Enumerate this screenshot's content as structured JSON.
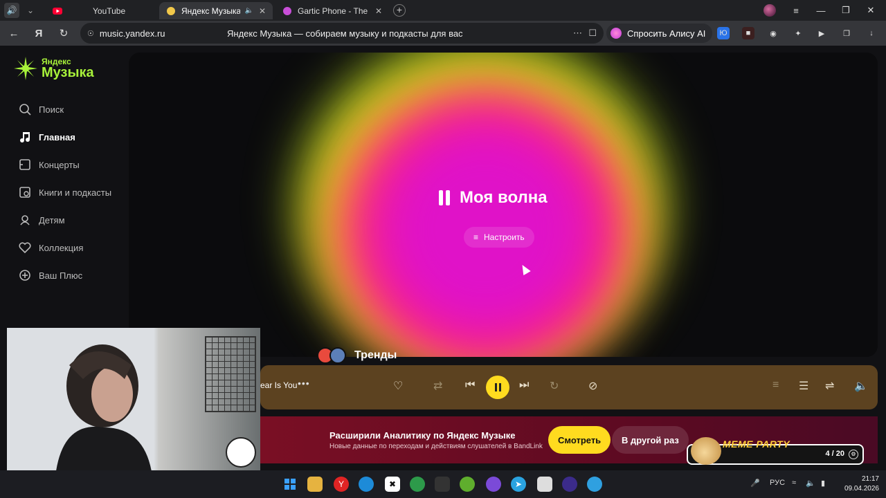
{
  "browser": {
    "tabs": [
      {
        "label": "YouTube",
        "active": false
      },
      {
        "label": "Яндекс Музыка — со",
        "active": true
      },
      {
        "label": "Gartic Phone - The Teleph",
        "active": false
      }
    ],
    "url_host": "music.yandex.ru",
    "page_title": "Яндекс Музыка — собираем музыку и подкасты для вас",
    "alice_label": "Спросить Алису AI"
  },
  "sidebar": {
    "logo_small": "Яндекс",
    "logo_big": "Музыка",
    "items": [
      {
        "label": "Поиск",
        "icon": "search-icon",
        "active": false
      },
      {
        "label": "Главная",
        "icon": "music-note-icon",
        "active": true
      },
      {
        "label": "Концерты",
        "icon": "ticket-icon",
        "active": false
      },
      {
        "label": "Книги и подкасты",
        "icon": "book-icon",
        "active": false
      },
      {
        "label": "Детям",
        "icon": "kids-icon",
        "active": false
      },
      {
        "label": "Коллекция",
        "icon": "heart-icon",
        "active": false
      },
      {
        "label": "Ваш Плюс",
        "icon": "plus-icon",
        "active": false
      }
    ]
  },
  "hero": {
    "title": "Моя волна",
    "tune_label": "Настроить"
  },
  "trends": {
    "title": "Тренды"
  },
  "player": {
    "track_title": "ear Is You",
    "accent": "#ffdb1f"
  },
  "banner": {
    "title": "Расширили Аналитику по Яндекс Музыке",
    "subtitle": "Новые данные по переходам и действиям слушателей в BandLink",
    "watch_label": "Смотреть",
    "later_label": "В другой раз"
  },
  "meme_overlay": {
    "title": "MEME PARTY",
    "count": "4 / 20"
  },
  "taskbar": {
    "lang": "РУС",
    "time": "21:17",
    "date": "09.04.2026"
  }
}
